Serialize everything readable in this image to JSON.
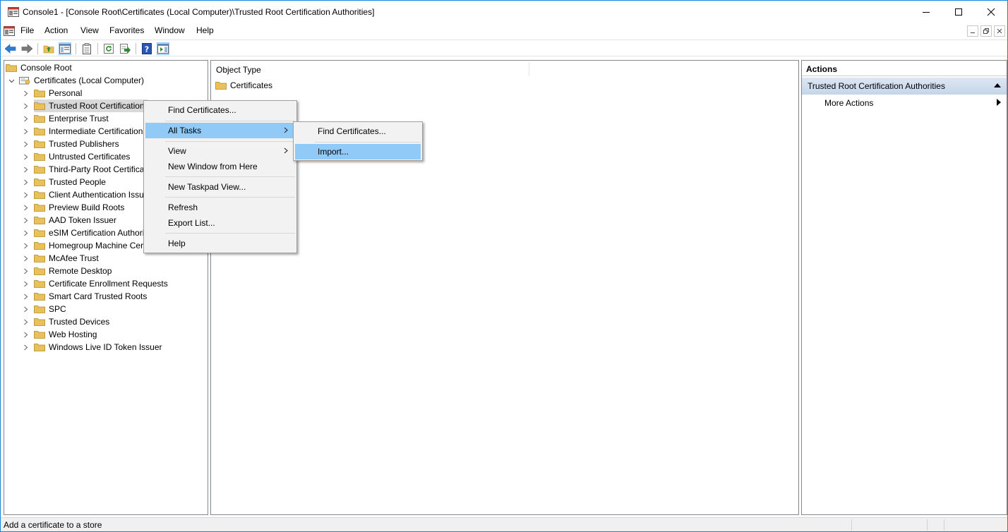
{
  "window": {
    "title": "Console1 - [Console Root\\Certificates (Local Computer)\\Trusted Root Certification Authorities]",
    "minimize": "—",
    "maximize": "☐",
    "close": "✕"
  },
  "menubar": {
    "items": [
      "File",
      "Action",
      "View",
      "Favorites",
      "Window",
      "Help"
    ]
  },
  "toolbar": {
    "icons": [
      "back-icon",
      "forward-icon",
      "up-folder-icon",
      "show-hide-tree-icon",
      "properties-icon",
      "refresh-icon",
      "export-list-icon",
      "help-icon",
      "show-hide-action-pane-icon"
    ]
  },
  "tree": {
    "root": "Console Root",
    "snapin": "Certificates (Local Computer)",
    "items": [
      "Personal",
      "Trusted Root Certification",
      "Enterprise Trust",
      "Intermediate Certification",
      "Trusted Publishers",
      "Untrusted Certificates",
      "Third-Party Root Certificat",
      "Trusted People",
      "Client Authentication Issu",
      "Preview Build Roots",
      "AAD Token Issuer",
      "eSIM Certification Authori",
      "Homegroup Machine Cer",
      "McAfee Trust",
      "Remote Desktop",
      "Certificate Enrollment Requests",
      "Smart Card Trusted Roots",
      "SPC",
      "Trusted Devices",
      "Web Hosting",
      "Windows Live ID Token Issuer"
    ],
    "selected_index": 1
  },
  "center": {
    "column_header": "Object Type",
    "rows": [
      "Certificates"
    ]
  },
  "actions": {
    "title": "Actions",
    "section": "Trusted Root Certification Authorities",
    "more_actions": "More Actions"
  },
  "context_menu": {
    "find": "Find Certificates...",
    "all_tasks": "All Tasks",
    "view": "View",
    "new_window": "New Window from Here",
    "new_taskpad": "New Taskpad View...",
    "refresh": "Refresh",
    "export": "Export List...",
    "help": "Help"
  },
  "submenu": {
    "find": "Find Certificates...",
    "import": "Import..."
  },
  "status": {
    "text": "Add a certificate to a store"
  },
  "colors": {
    "highlight": "#91c9f7",
    "window_border": "#1883d7",
    "folder": "#e8c15a"
  }
}
